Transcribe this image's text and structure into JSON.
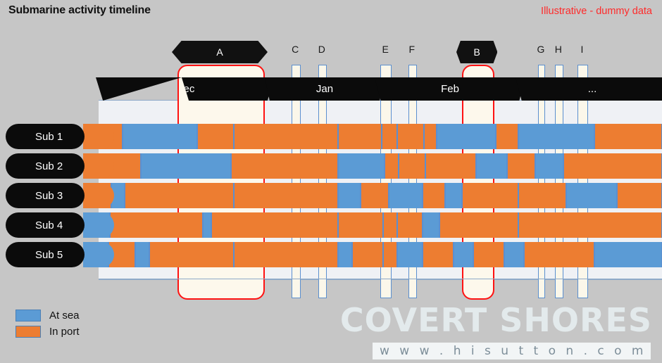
{
  "header": {
    "title": "Submarine activity timeline",
    "disclaimer": "Illustrative - dummy data"
  },
  "legend": {
    "items": [
      {
        "label": "At sea",
        "color": "#5b9bd5",
        "key": "sea"
      },
      {
        "label": "In port",
        "color": "#ed7d31",
        "key": "port"
      }
    ]
  },
  "watermark": {
    "brand": "COVERT SHORES",
    "url": "w w w . h i s u t t o n . c o m"
  },
  "colors": {
    "background": "#c6c6c6",
    "at_sea": "#5b9bd5",
    "in_port": "#ed7d31",
    "highlight_band": "#fbf5e4",
    "red_marker": "#ff1212",
    "blue_marker": "#5b8fd0",
    "black": "#0b0b0b",
    "plot_background": "#eff1f5"
  },
  "chart_data": {
    "type": "timeline",
    "title": "Submarine activity timeline",
    "xlabel": "",
    "ylabel": "",
    "x_axis": {
      "type": "time",
      "months": [
        {
          "label": "Dec",
          "start_pct": 0.0,
          "end_pct": 30.0
        },
        {
          "label": "Jan",
          "start_pct": 30.0,
          "end_pct": 49.5
        },
        {
          "label": "Feb",
          "start_pct": 49.5,
          "end_pct": 74.5
        },
        {
          "label": "...",
          "start_pct": 74.5,
          "end_pct": 100.0
        }
      ]
    },
    "legend_entries": [
      "At sea",
      "In port"
    ],
    "legend_position": "bottom-left",
    "grid": false,
    "series": [
      {
        "name": "Sub 1",
        "segments": [
          {
            "state": "port",
            "start_pct": 0.0,
            "end_pct": 4.2
          },
          {
            "state": "sea",
            "start_pct": 4.2,
            "end_pct": 17.5
          },
          {
            "state": "port",
            "start_pct": 17.5,
            "end_pct": 24.0
          },
          {
            "state": "port",
            "start_pct": 24.0,
            "end_pct": 42.5
          },
          {
            "state": "port",
            "start_pct": 42.5,
            "end_pct": 50.2
          },
          {
            "state": "port",
            "start_pct": 50.2,
            "end_pct": 53.0
          },
          {
            "state": "port",
            "start_pct": 53.0,
            "end_pct": 57.8
          },
          {
            "state": "port",
            "start_pct": 57.8,
            "end_pct": 60.0
          },
          {
            "state": "sea",
            "start_pct": 60.0,
            "end_pct": 70.5
          },
          {
            "state": "port",
            "start_pct": 70.5,
            "end_pct": 74.5
          },
          {
            "state": "sea",
            "start_pct": 74.5,
            "end_pct": 88.0
          },
          {
            "state": "port",
            "start_pct": 88.0,
            "end_pct": 100.0
          }
        ]
      },
      {
        "name": "Sub 2",
        "segments": [
          {
            "state": "port",
            "start_pct": 0.0,
            "end_pct": 7.5
          },
          {
            "state": "sea",
            "start_pct": 7.5,
            "end_pct": 23.5
          },
          {
            "state": "port",
            "start_pct": 23.5,
            "end_pct": 42.5
          },
          {
            "state": "sea",
            "start_pct": 42.5,
            "end_pct": 50.8
          },
          {
            "state": "port",
            "start_pct": 50.8,
            "end_pct": 53.2
          },
          {
            "state": "port",
            "start_pct": 53.2,
            "end_pct": 58.0
          },
          {
            "state": "port",
            "start_pct": 58.0,
            "end_pct": 67.0
          },
          {
            "state": "sea",
            "start_pct": 67.0,
            "end_pct": 72.5
          },
          {
            "state": "port",
            "start_pct": 72.5,
            "end_pct": 77.5
          },
          {
            "state": "sea",
            "start_pct": 77.5,
            "end_pct": 82.5
          },
          {
            "state": "port",
            "start_pct": 82.5,
            "end_pct": 100.0
          }
        ]
      },
      {
        "name": "Sub 3",
        "segments": [
          {
            "state": "port",
            "start_pct": 0.0,
            "end_pct": 2.2
          },
          {
            "state": "sea",
            "start_pct": 2.2,
            "end_pct": 4.6
          },
          {
            "state": "port",
            "start_pct": 4.6,
            "end_pct": 24.0
          },
          {
            "state": "port",
            "start_pct": 24.0,
            "end_pct": 42.5
          },
          {
            "state": "sea",
            "start_pct": 42.5,
            "end_pct": 46.5
          },
          {
            "state": "port",
            "start_pct": 46.5,
            "end_pct": 51.5
          },
          {
            "state": "sea",
            "start_pct": 51.5,
            "end_pct": 57.5
          },
          {
            "state": "port",
            "start_pct": 57.5,
            "end_pct": 61.5
          },
          {
            "state": "sea",
            "start_pct": 61.5,
            "end_pct": 64.5
          },
          {
            "state": "port",
            "start_pct": 64.5,
            "end_pct": 74.5
          },
          {
            "state": "port",
            "start_pct": 74.5,
            "end_pct": 83.0
          },
          {
            "state": "sea",
            "start_pct": 83.0,
            "end_pct": 92.0
          },
          {
            "state": "port",
            "start_pct": 92.0,
            "end_pct": 100.0
          }
        ]
      },
      {
        "name": "Sub 4",
        "segments": [
          {
            "state": "sea",
            "start_pct": 0.0,
            "end_pct": 2.0
          },
          {
            "state": "port",
            "start_pct": 2.0,
            "end_pct": 18.5
          },
          {
            "state": "sea",
            "start_pct": 18.5,
            "end_pct": 20.0
          },
          {
            "state": "port",
            "start_pct": 20.0,
            "end_pct": 42.5
          },
          {
            "state": "port",
            "start_pct": 42.5,
            "end_pct": 50.5
          },
          {
            "state": "port",
            "start_pct": 50.5,
            "end_pct": 53.0
          },
          {
            "state": "port",
            "start_pct": 53.0,
            "end_pct": 57.5
          },
          {
            "state": "sea",
            "start_pct": 57.5,
            "end_pct": 60.5
          },
          {
            "state": "port",
            "start_pct": 60.5,
            "end_pct": 74.5
          },
          {
            "state": "port",
            "start_pct": 74.5,
            "end_pct": 100.0
          }
        ]
      },
      {
        "name": "Sub 5",
        "segments": [
          {
            "state": "sea",
            "start_pct": 0.0,
            "end_pct": 1.8
          },
          {
            "state": "port",
            "start_pct": 1.8,
            "end_pct": 6.5
          },
          {
            "state": "sea",
            "start_pct": 6.5,
            "end_pct": 9.0
          },
          {
            "state": "port",
            "start_pct": 9.0,
            "end_pct": 24.0
          },
          {
            "state": "port",
            "start_pct": 24.0,
            "end_pct": 42.5
          },
          {
            "state": "sea",
            "start_pct": 42.5,
            "end_pct": 45.0
          },
          {
            "state": "port",
            "start_pct": 45.0,
            "end_pct": 50.5
          },
          {
            "state": "port",
            "start_pct": 50.5,
            "end_pct": 53.0
          },
          {
            "state": "sea",
            "start_pct": 53.0,
            "end_pct": 57.5
          },
          {
            "state": "port",
            "start_pct": 57.5,
            "end_pct": 63.0
          },
          {
            "state": "sea",
            "start_pct": 63.0,
            "end_pct": 66.5
          },
          {
            "state": "port",
            "start_pct": 66.5,
            "end_pct": 72.0
          },
          {
            "state": "sea",
            "start_pct": 72.0,
            "end_pct": 75.5
          },
          {
            "state": "port",
            "start_pct": 75.5,
            "end_pct": 88.0
          },
          {
            "state": "sea",
            "start_pct": 88.0,
            "end_pct": 100.0
          }
        ]
      }
    ],
    "event_markers": [
      {
        "label": "A",
        "style": "wide-red",
        "start_pct": 14.0,
        "end_pct": 29.0,
        "callout": "hex"
      },
      {
        "label": "C",
        "style": "narrow-blue",
        "start_pct": 34.2,
        "end_pct": 35.6,
        "callout": "plain"
      },
      {
        "label": "D",
        "style": "narrow-blue",
        "start_pct": 39.0,
        "end_pct": 40.2,
        "callout": "plain"
      },
      {
        "label": "E",
        "style": "narrow-blue",
        "start_pct": 50.0,
        "end_pct": 51.8,
        "callout": "plain"
      },
      {
        "label": "F",
        "style": "narrow-blue",
        "start_pct": 55.0,
        "end_pct": 56.2,
        "callout": "plain"
      },
      {
        "label": "B",
        "style": "wide-red",
        "start_pct": 64.5,
        "end_pct": 69.8,
        "callout": "hex"
      },
      {
        "label": "G",
        "style": "narrow-blue",
        "start_pct": 78.0,
        "end_pct": 79.0,
        "callout": "plain"
      },
      {
        "label": "H",
        "style": "narrow-blue",
        "start_pct": 81.0,
        "end_pct": 82.2,
        "callout": "plain"
      },
      {
        "label": "I",
        "style": "narrow-blue",
        "start_pct": 85.0,
        "end_pct": 86.6,
        "callout": "plain"
      }
    ]
  }
}
